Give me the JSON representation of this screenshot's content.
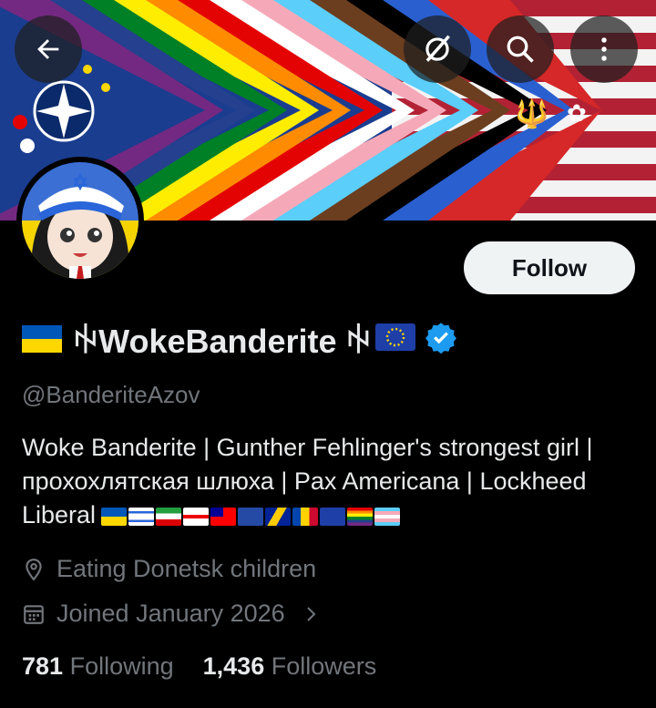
{
  "header": {
    "back_icon": "arrow-left-icon",
    "grok_icon": "grok-icon",
    "search_icon": "search-icon",
    "more_icon": "more-vertical-icon"
  },
  "profile": {
    "display_name": "ꑭWokeBanderite ꑭ",
    "handle": "@BanderiteAzov",
    "verified_color": "#1d9bf0",
    "follow_label": "Follow",
    "bio_line1": "Woke Banderite | Gunther Fehlinger's strongest girl |",
    "bio_line2": "прохохлятская шлюха | Pax Americana | Lockheed",
    "bio_line3": "Liberal",
    "location": "Eating Donetsk children",
    "joined": "Joined January 2026",
    "following_count": "781",
    "following_label": "Following",
    "followers_count": "1,436",
    "followers_label": "Followers"
  }
}
